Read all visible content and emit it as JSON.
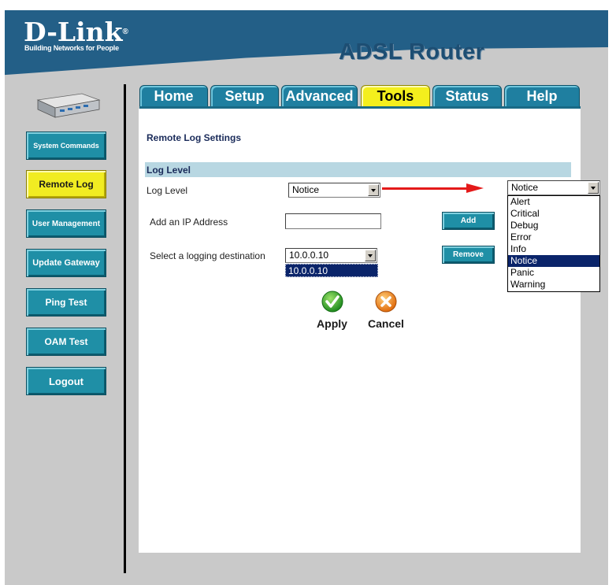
{
  "header": {
    "brand": "D-Link",
    "tagline": "Building Networks for People",
    "product": "ADSL Router"
  },
  "sidebar": {
    "items": [
      {
        "label": "System Commands",
        "active": false
      },
      {
        "label": "Remote Log",
        "active": true
      },
      {
        "label": "User Management",
        "active": false
      },
      {
        "label": "Update Gateway",
        "active": false
      },
      {
        "label": "Ping Test",
        "active": false
      },
      {
        "label": "OAM Test",
        "active": false
      },
      {
        "label": "Logout",
        "active": false
      }
    ]
  },
  "tabs": [
    {
      "label": "Home",
      "active": false
    },
    {
      "label": "Setup",
      "active": false
    },
    {
      "label": "Advanced",
      "active": false
    },
    {
      "label": "Tools",
      "active": true
    },
    {
      "label": "Status",
      "active": false
    },
    {
      "label": "Help",
      "active": false
    }
  ],
  "main": {
    "section_title": "Remote Log Settings",
    "log_level_header": "Log Level",
    "log_level_label": "Log Level",
    "log_level_value": "Notice",
    "add_ip_label": "Add an IP Address",
    "add_ip_value": "",
    "add_button": "Add",
    "destination_label": "Select a logging destination",
    "destination_value": "10.0.0.10",
    "destination_option": "10.0.0.10",
    "remove_button": "Remove",
    "apply_label": "Apply",
    "cancel_label": "Cancel"
  },
  "dropdown": {
    "current": "Notice",
    "options": [
      "Alert",
      "Critical",
      "Debug",
      "Error",
      "Info",
      "Notice",
      "Panic",
      "Warning"
    ],
    "selected": "Notice"
  },
  "colors": {
    "header_blue": "#235f87",
    "accent_teal": "#1f8fa6",
    "active_yellow": "#f4ef1d",
    "arrow_red": "#e41a1a",
    "selection_navy": "#0a246a"
  }
}
